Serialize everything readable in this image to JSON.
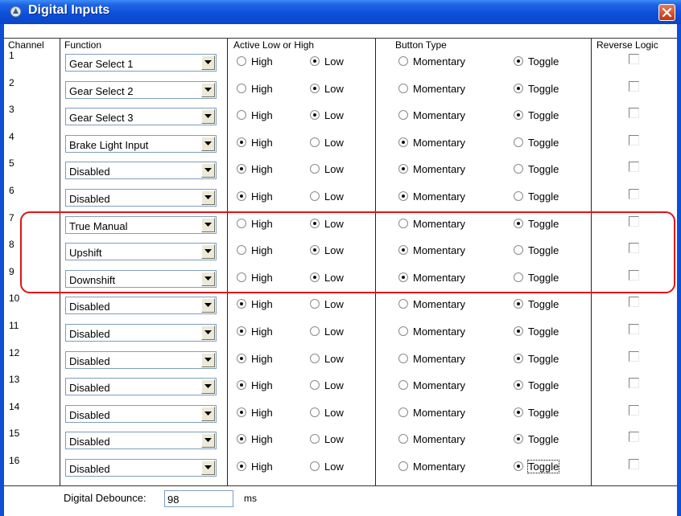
{
  "window": {
    "title": "Digital Inputs"
  },
  "headers": {
    "channel": "Channel",
    "function": "Function",
    "active": "Active Low or High",
    "button_type": "Button Type",
    "reverse": "Reverse Logic"
  },
  "option_labels": {
    "high": "High",
    "low": "Low",
    "momentary": "Momentary",
    "toggle": "Toggle"
  },
  "rows": [
    {
      "channel": "1",
      "function": "Gear Select 1",
      "active": "Low",
      "button": "Toggle",
      "reverse": false
    },
    {
      "channel": "2",
      "function": "Gear Select 2",
      "active": "Low",
      "button": "Toggle",
      "reverse": false
    },
    {
      "channel": "3",
      "function": "Gear Select 3",
      "active": "Low",
      "button": "Toggle",
      "reverse": false
    },
    {
      "channel": "4",
      "function": "Brake Light Input",
      "active": "High",
      "button": "Momentary",
      "reverse": false
    },
    {
      "channel": "5",
      "function": "Disabled",
      "active": "High",
      "button": "Momentary",
      "reverse": false
    },
    {
      "channel": "6",
      "function": "Disabled",
      "active": "High",
      "button": "Momentary",
      "reverse": false
    },
    {
      "channel": "7",
      "function": "True Manual",
      "active": "Low",
      "button": "Toggle",
      "reverse": false
    },
    {
      "channel": "8",
      "function": "Upshift",
      "active": "Low",
      "button": "Momentary",
      "reverse": false
    },
    {
      "channel": "9",
      "function": "Downshift",
      "active": "Low",
      "button": "Momentary",
      "reverse": false
    },
    {
      "channel": "10",
      "function": "Disabled",
      "active": "High",
      "button": "Toggle",
      "reverse": false
    },
    {
      "channel": "11",
      "function": "Disabled",
      "active": "High",
      "button": "Toggle",
      "reverse": false
    },
    {
      "channel": "12",
      "function": "Disabled",
      "active": "High",
      "button": "Toggle",
      "reverse": false
    },
    {
      "channel": "13",
      "function": "Disabled",
      "active": "High",
      "button": "Toggle",
      "reverse": false
    },
    {
      "channel": "14",
      "function": "Disabled",
      "active": "High",
      "button": "Toggle",
      "reverse": false
    },
    {
      "channel": "15",
      "function": "Disabled",
      "active": "High",
      "button": "Toggle",
      "reverse": false
    },
    {
      "channel": "16",
      "function": "Disabled",
      "active": "High",
      "button": "Toggle",
      "reverse": false,
      "toggle_focused": true
    }
  ],
  "debounce": {
    "label": "Digital Debounce:",
    "value": "98",
    "unit": "ms"
  },
  "colors": {
    "title_bar": "#0b4fd9",
    "highlight": "#e31212",
    "close_button": "#c2350e"
  }
}
